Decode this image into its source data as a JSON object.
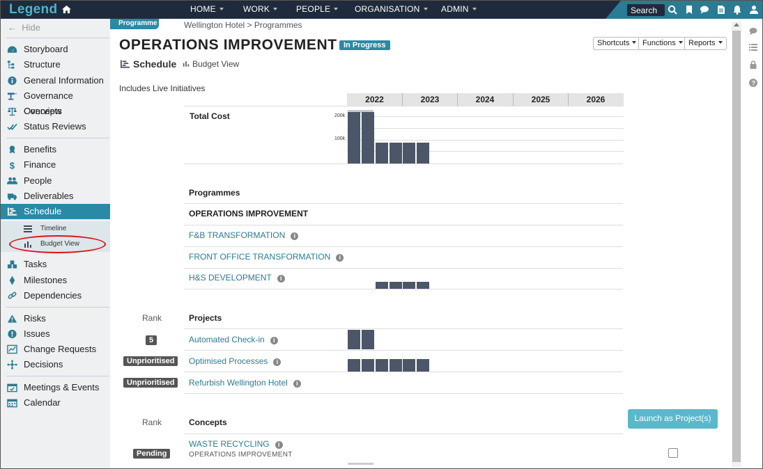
{
  "app": {
    "logo": "Legend"
  },
  "nav": [
    {
      "label": "HOME"
    },
    {
      "label": "WORK"
    },
    {
      "label": "PEOPLE"
    },
    {
      "label": "ORGANISATION"
    },
    {
      "label": "ADMIN"
    }
  ],
  "search": {
    "label": "Search"
  },
  "sidebar": {
    "hide": "Hide",
    "items": [
      {
        "label": "Storyboard",
        "icon": "dashboard-icon"
      },
      {
        "label": "Structure",
        "icon": "hierarchy-icon"
      },
      {
        "label": "General Information",
        "icon": "info-icon"
      },
      {
        "label": "Governance Overview",
        "icon": "governance-icon"
      },
      {
        "label": "Concepts",
        "icon": "scales-icon"
      },
      {
        "label": "Status Reviews",
        "icon": "check-icon"
      },
      {
        "label": "Benefits",
        "icon": "award-icon"
      },
      {
        "label": "Finance",
        "icon": "dollar-icon"
      },
      {
        "label": "People",
        "icon": "people-icon"
      },
      {
        "label": "Deliverables",
        "icon": "truck-icon"
      },
      {
        "label": "Schedule",
        "icon": "schedule-icon"
      },
      {
        "label": "Tasks",
        "icon": "cubes-icon"
      },
      {
        "label": "Milestones",
        "icon": "diamond-icon"
      },
      {
        "label": "Dependencies",
        "icon": "link-icon"
      },
      {
        "label": "Risks",
        "icon": "warning-icon"
      },
      {
        "label": "Issues",
        "icon": "alert-icon"
      },
      {
        "label": "Change Requests",
        "icon": "chart-icon"
      },
      {
        "label": "Decisions",
        "icon": "decision-icon"
      },
      {
        "label": "Meetings & Events",
        "icon": "calendar-check-icon"
      },
      {
        "label": "Calendar",
        "icon": "calendar-icon"
      }
    ],
    "subitems": [
      {
        "label": "Timeline"
      },
      {
        "label": "Budget View"
      }
    ]
  },
  "header": {
    "tag": "Programme",
    "breadcrumb": "Wellington Hotel > Programmes",
    "title": "OPERATIONS IMPROVEMENT",
    "status": "In Progress",
    "buttons": [
      "Shortcuts",
      "Functions",
      "Reports"
    ],
    "tab_schedule": "Schedule",
    "tab_budget": "Budget View"
  },
  "includes": "Includes Live Initiatives",
  "years": [
    "2022",
    "2023",
    "2024",
    "2025",
    "2026"
  ],
  "total_cost": {
    "label": "Total Cost",
    "ticks": [
      "200k",
      "100k"
    ]
  },
  "programmes": {
    "heading": "Programmes",
    "parent": "OPERATIONS IMPROVEMENT",
    "items": [
      "F&B TRANSFORMATION",
      "FRONT OFFICE TRANSFORMATION",
      "H&S DEVELOPMENT"
    ]
  },
  "projects": {
    "rank_label": "Rank",
    "heading": "Projects",
    "items": [
      {
        "name": "Automated Check-in",
        "rank": "5"
      },
      {
        "name": "Optimised Processes",
        "rank": "Unprioritised"
      },
      {
        "name": "Refurbish Wellington Hotel",
        "rank": "Unprioritised"
      }
    ]
  },
  "concepts": {
    "rank_label": "Rank",
    "heading": "Concepts",
    "launch": "Launch as Project(s)",
    "items": [
      {
        "name": "WASTE RECYCLING",
        "parent": "OPERATIONS IMPROVEMENT",
        "rank": "Pending"
      }
    ]
  }
}
